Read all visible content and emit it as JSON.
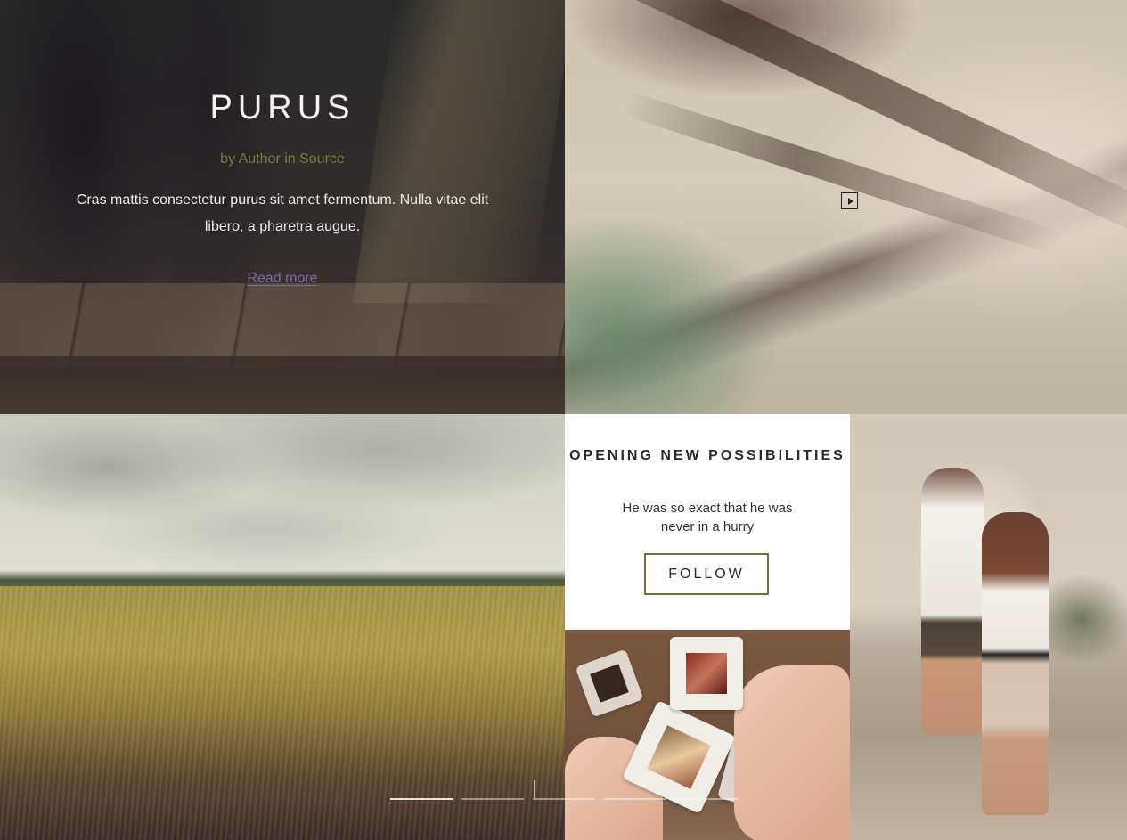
{
  "hero": {
    "title": "PURUS",
    "byline": "by Author in Source",
    "text": "Cras mattis consectetur purus sit amet fermentum. Nulla vitae elit libero, a pharetra augue.",
    "link_label": "Read more"
  },
  "video": {
    "icon": "play-icon"
  },
  "promo": {
    "title": "OPENING NEW POSSIBILITIES",
    "text": "He was so exact that he was never in a hurry",
    "button_label": "FOLLOW"
  },
  "slider": {
    "count": 5,
    "active_index": 0
  },
  "colors": {
    "accent_olive": "#7a6f33",
    "link_purple": "#7a6aa8",
    "byline_olive": "#7d7a3a"
  }
}
